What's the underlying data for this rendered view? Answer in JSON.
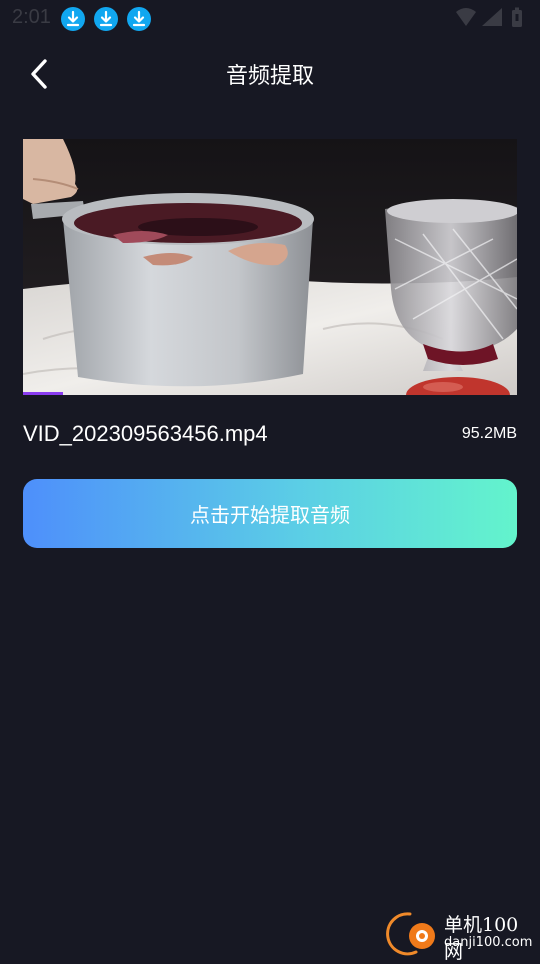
{
  "status_bar": {
    "time": "2:01",
    "notifications": [
      "download-icon",
      "download-icon",
      "download-icon"
    ],
    "icons": [
      "wifi-icon",
      "signal-icon",
      "battery-icon"
    ]
  },
  "header": {
    "back_icon": "chevron-left-icon",
    "title": "音频提取"
  },
  "video": {
    "progress": 0.08,
    "progress_color": "#8a3cf0"
  },
  "file": {
    "name": "VID_202309563456.mp4",
    "size": "95.2MB"
  },
  "actions": {
    "extract_label": "点击开始提取音频"
  },
  "watermark": {
    "line1": "单机100网",
    "line2": "danji100.com"
  },
  "colors": {
    "background": "#171823",
    "button_gradient_start": "#4e8ffb",
    "button_gradient_end": "#63f4cc",
    "notification_blue": "#11a7f0"
  }
}
